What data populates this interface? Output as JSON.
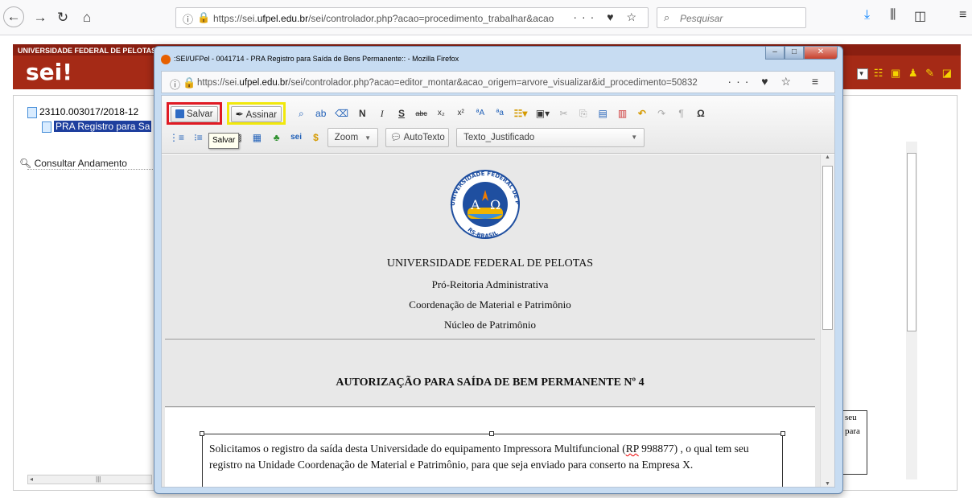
{
  "browser": {
    "url_prefix": "https://sei.",
    "url_domain": "ufpel.edu.br",
    "url_rest": "/sei/controlador.php?acao=procedimento_trabalhar&acao",
    "search_placeholder": "Pesquisar",
    "page_actions": "··· ♥ ☆"
  },
  "sei": {
    "institution": "UNIVERSIDADE FEDERAL DE PELOTAS",
    "logo": "sei!",
    "tree": {
      "process_number": "23110.003017/2018-12",
      "selected_document": "PRA Registro para Sa",
      "consult_link": "Consultar Andamento"
    },
    "right_fragment": [
      "seu",
      "para"
    ]
  },
  "popup": {
    "title": ":SEI/UFPel - 0041714 - PRA Registro para Saída de Bens Permanente:: - Mozilla Firefox",
    "url_prefix": "https://sei.",
    "url_domain": "ufpel.edu.br",
    "url_rest": "/sei/controlador.php?acao=editor_montar&acao_origem=arvore_visualizar&id_procedimento=50832",
    "toolbar": {
      "save_label": "Salvar",
      "sign_label": "Assinar",
      "zoom_label": "Zoom",
      "autotext_label": "AutoTexto",
      "style_label": "Texto_Justificado",
      "tooltip": "Salvar"
    },
    "document": {
      "crest_ring_top": "UNIVERSIDADE FEDERAL DE PELOTAS",
      "crest_ring_bottom": "RS-BRASIL",
      "line1": "UNIVERSIDADE FEDERAL DE PELOTAS",
      "line2": "Pró-Reitoria Administrativa",
      "line3": "Coordenação de Material e Patrimônio",
      "line4": "Núcleo de Patrimônio",
      "title": "AUTORIZAÇÃO PARA SAÍDA DE BEM PERMANENTE Nº 4",
      "para_part1": "Solicitamos o registro da saída desta Universidade do equipamento Impressora Multifuncional (",
      "para_rp": "RP",
      "para_part2": " 998877) , o qual tem seu registro na Unidade Coordenação de Material e Patrimônio, para que seja enviado para conserto na Empresa X."
    }
  },
  "colors": {
    "sei_header": "#a52a16",
    "save_highlight": "#e01b24",
    "sign_highlight": "#f1e80c"
  }
}
